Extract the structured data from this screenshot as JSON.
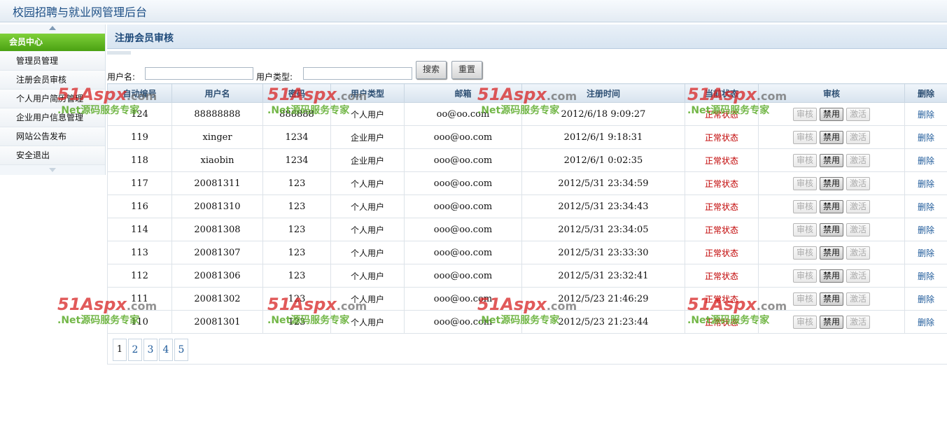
{
  "app": {
    "title": "校园招聘与就业网管理后台"
  },
  "sidebar": {
    "header": "会员中心",
    "items": [
      {
        "label": "管理员管理"
      },
      {
        "label": "注册会员审核"
      },
      {
        "label": "个人用户简历管理"
      },
      {
        "label": "企业用户信息管理"
      },
      {
        "label": "网站公告发布"
      },
      {
        "label": "安全退出"
      }
    ]
  },
  "main": {
    "title": "注册会员审核"
  },
  "search": {
    "username_label": "用户名:",
    "username_value": "",
    "usertype_label": "用户类型:",
    "usertype_value": "",
    "search_button": "搜索",
    "reset_button": "重置"
  },
  "table": {
    "columns": [
      "自动编号",
      "用户名",
      "密码",
      "用户类型",
      "邮箱",
      "注册时间",
      "当前状态",
      "审核",
      "删除"
    ],
    "action_labels": {
      "review": "审核",
      "disable": "禁用",
      "activate": "激活",
      "delete": "删除"
    },
    "rows": [
      {
        "id": "124",
        "username": "88888888",
        "password": "888888",
        "type": "个人用户",
        "email": "oo@oo.com",
        "time": "2012/6/18 9:09:27",
        "status": "正常状态"
      },
      {
        "id": "119",
        "username": "xinger",
        "password": "1234",
        "type": "企业用户",
        "email": "ooo@oo.com",
        "time": "2012/6/1 9:18:31",
        "status": "正常状态"
      },
      {
        "id": "118",
        "username": "xiaobin",
        "password": "1234",
        "type": "企业用户",
        "email": "ooo@oo.com",
        "time": "2012/6/1 0:02:35",
        "status": "正常状态"
      },
      {
        "id": "117",
        "username": "20081311",
        "password": "123",
        "type": "个人用户",
        "email": "ooo@oo.com",
        "time": "2012/5/31 23:34:59",
        "status": "正常状态"
      },
      {
        "id": "116",
        "username": "20081310",
        "password": "123",
        "type": "个人用户",
        "email": "ooo@oo.com",
        "time": "2012/5/31 23:34:43",
        "status": "正常状态"
      },
      {
        "id": "114",
        "username": "20081308",
        "password": "123",
        "type": "个人用户",
        "email": "ooo@oo.com",
        "time": "2012/5/31 23:34:05",
        "status": "正常状态"
      },
      {
        "id": "113",
        "username": "20081307",
        "password": "123",
        "type": "个人用户",
        "email": "ooo@oo.com",
        "time": "2012/5/31 23:33:30",
        "status": "正常状态"
      },
      {
        "id": "112",
        "username": "20081306",
        "password": "123",
        "type": "个人用户",
        "email": "ooo@oo.com",
        "time": "2012/5/31 23:32:41",
        "status": "正常状态"
      },
      {
        "id": "111",
        "username": "20081302",
        "password": "123",
        "type": "个人用户",
        "email": "ooo@oo.com",
        "time": "2012/5/23 21:46:29",
        "status": "正常状态"
      },
      {
        "id": "110",
        "username": "20081301",
        "password": "123",
        "type": "个人用户",
        "email": "ooo@oo.com",
        "time": "2012/5/23 21:23:44",
        "status": "正常状态"
      }
    ]
  },
  "pager": {
    "pages": [
      "1",
      "2",
      "3",
      "4",
      "5"
    ],
    "current": "1"
  },
  "watermark": {
    "brand": "51Aspx",
    "domain": ".com",
    "slogan": ".Net源码服务专家"
  },
  "colors": {
    "status": "#c00000",
    "accent_green": "#4aa112",
    "link": "#1e5a9a"
  }
}
